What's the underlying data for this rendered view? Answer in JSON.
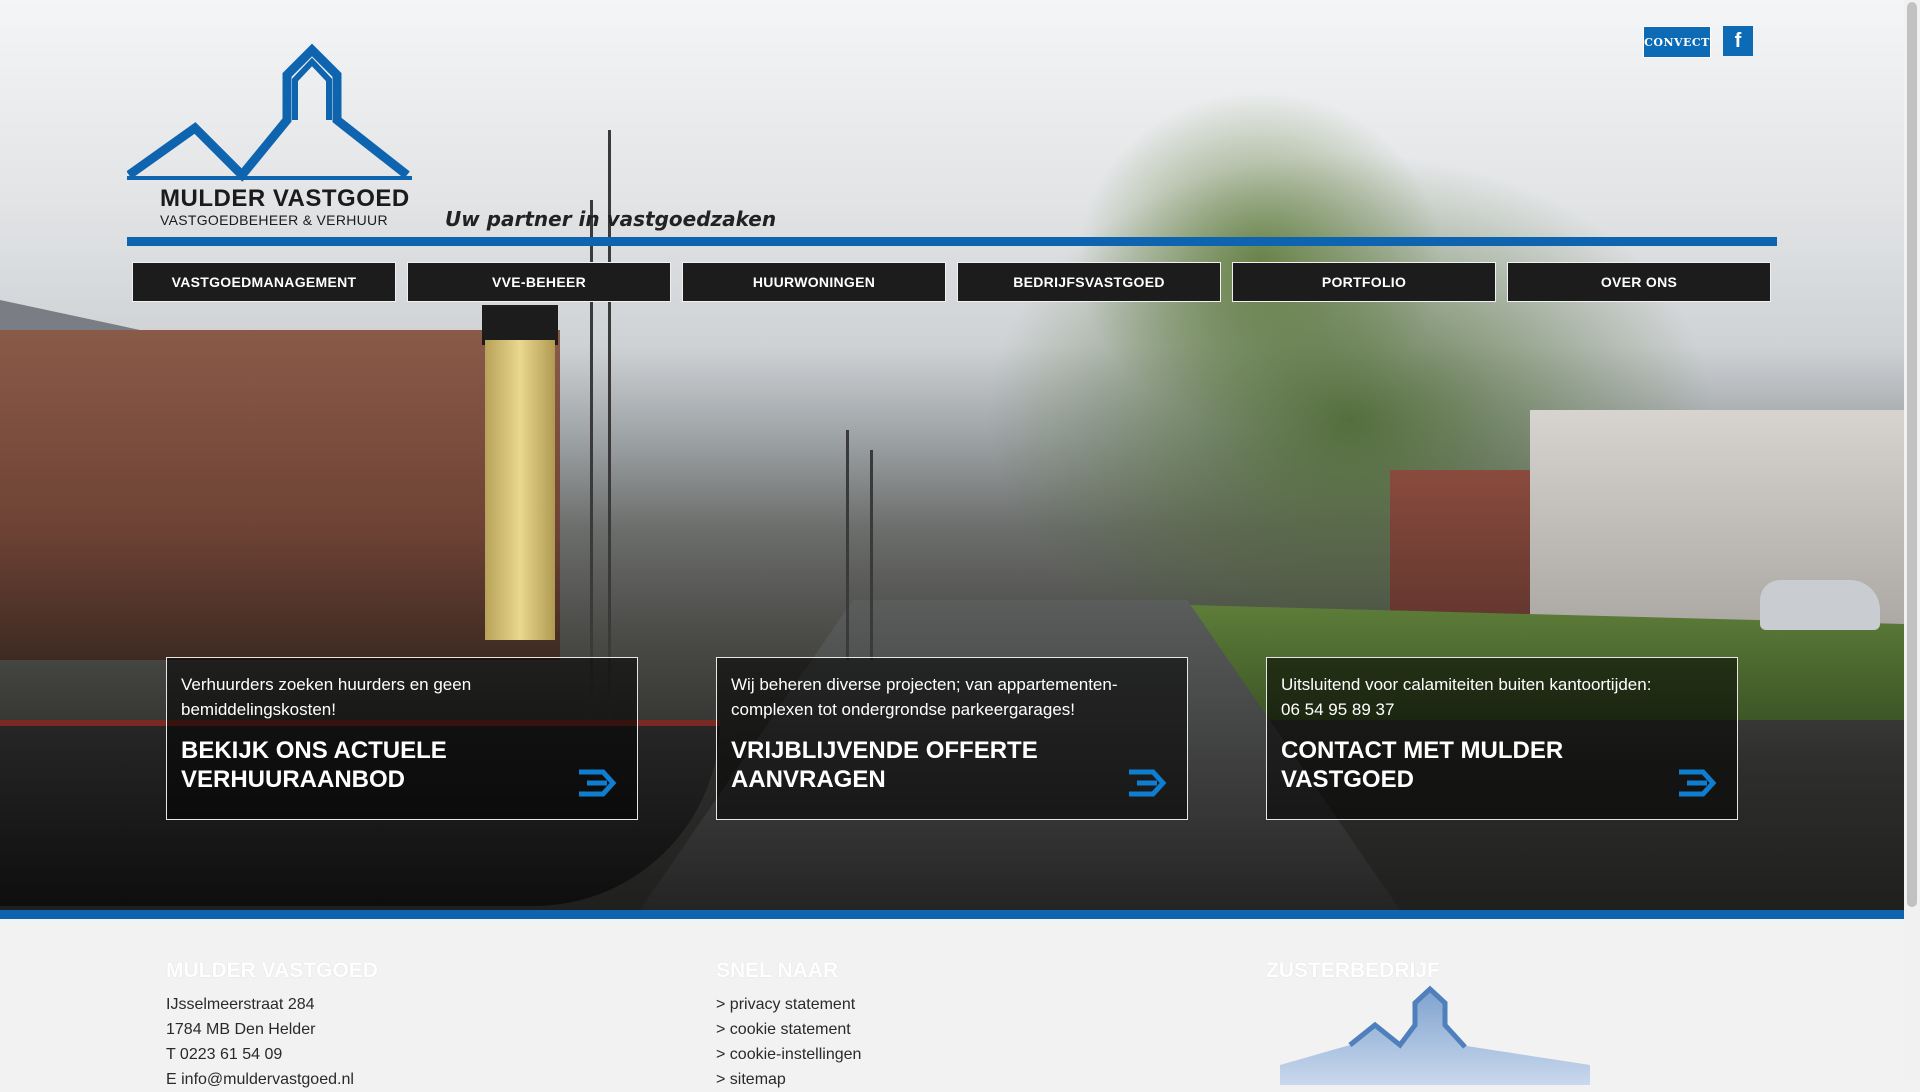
{
  "brand": {
    "name": "MULDER VASTGOED",
    "subtitle": "VASTGOEDBEHEER & VERHUUR",
    "tagline": "Uw partner in vastgoedzaken",
    "accent_color": "#0f64b0"
  },
  "top_links": {
    "convect_label": "CONVECT",
    "facebook_label": "f"
  },
  "nav": {
    "items": [
      {
        "label": "VASTGOEDMANAGEMENT"
      },
      {
        "label": "VVE-BEHEER"
      },
      {
        "label": "HUURWONINGEN"
      },
      {
        "label": "BEDRIJFSVASTGOED"
      },
      {
        "label": "PORTFOLIO"
      },
      {
        "label": "OVER ONS"
      }
    ]
  },
  "cta": [
    {
      "intro": "Verhuurders zoeken huurders en geen bemiddelingskosten!",
      "title": "BEKIJK ONS ACTUELE VERHUURAANBOD"
    },
    {
      "intro": "Wij beheren diverse projecten; van appartementen-complexen tot ondergrondse parkeergarages!",
      "title": "VRIJBLIJVENDE OFFERTE AANVRAGEN"
    },
    {
      "intro": "Uitsluitend voor calamiteiten buiten kantoortijden:",
      "phone": "06 54 95 89 37",
      "title": "CONTACT MET MULDER VASTGOED"
    }
  ],
  "footer": {
    "col1": {
      "heading": "MULDER VASTGOED",
      "address": "IJsselmeerstraat 284",
      "postal": "1784 MB Den Helder",
      "phone": "T 0223 61 54 09",
      "email": "E info@muldervastgoed.nl"
    },
    "col2": {
      "heading": "SNEL NAAR",
      "links": [
        "> privacy statement",
        "> cookie statement",
        "> cookie-instellingen",
        "> sitemap"
      ]
    },
    "col3": {
      "heading": "ZUSTERBEDRIJF"
    }
  }
}
